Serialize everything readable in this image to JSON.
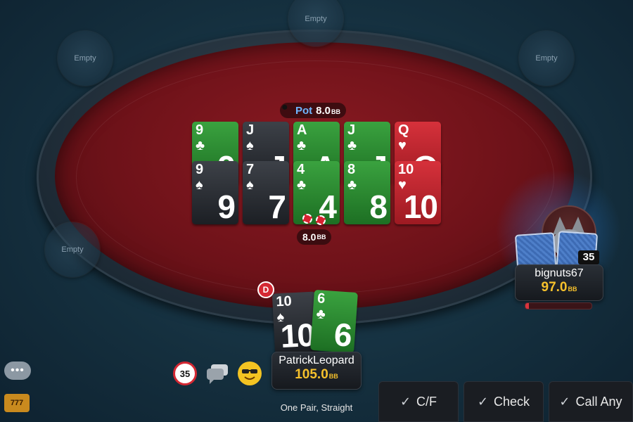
{
  "seats": {
    "empty_label": "Empty",
    "top": "Empty",
    "top_left": "Empty",
    "top_right": "Empty",
    "left": "Empty"
  },
  "pot": {
    "label": "Pot",
    "amount": "8.0",
    "unit": "BB"
  },
  "board": {
    "row1": [
      {
        "rank": "9",
        "suit": "♣",
        "color": "green"
      },
      {
        "rank": "J",
        "suit": "♠",
        "color": "black"
      },
      {
        "rank": "A",
        "suit": "♣",
        "color": "green"
      },
      {
        "rank": "J",
        "suit": "♣",
        "color": "green"
      },
      {
        "rank": "Q",
        "suit": "♥",
        "color": "red"
      }
    ],
    "row2": [
      {
        "rank": "9",
        "suit": "♠",
        "color": "black"
      },
      {
        "rank": "7",
        "suit": "♠",
        "color": "black"
      },
      {
        "rank": "4",
        "suit": "♣",
        "color": "green"
      },
      {
        "rank": "8",
        "suit": "♣",
        "color": "green"
      },
      {
        "rank": "10",
        "suit": "♥",
        "color": "red"
      }
    ]
  },
  "bet": {
    "amount": "8.0",
    "unit": "BB"
  },
  "dealer_button": "D",
  "hero": {
    "name": "PatrickLeopard",
    "stack": "105.0",
    "unit": "BB",
    "cards": [
      {
        "rank": "10",
        "suit": "♠",
        "color": "black"
      },
      {
        "rank": "6",
        "suit": "♣",
        "color": "green"
      }
    ],
    "hand_description": "One Pair, Straight"
  },
  "opponent": {
    "name": "bignuts67",
    "stack": "97.0",
    "unit": "BB",
    "card_count": "35",
    "timer_fraction": 0.05
  },
  "timer_icon_value": "35",
  "actions": [
    {
      "label": "C/F",
      "icon": "check-icon"
    },
    {
      "label": "Check",
      "icon": "check-icon"
    },
    {
      "label": "Call Any",
      "icon": "check-icon"
    }
  ],
  "colors": {
    "felt": "#6e1219",
    "stack_gold": "#f6c12c",
    "pot_blue": "#6fb6ff",
    "card_green": "#2a8a30",
    "card_red": "#c0262f",
    "card_black": "#2c3036"
  }
}
